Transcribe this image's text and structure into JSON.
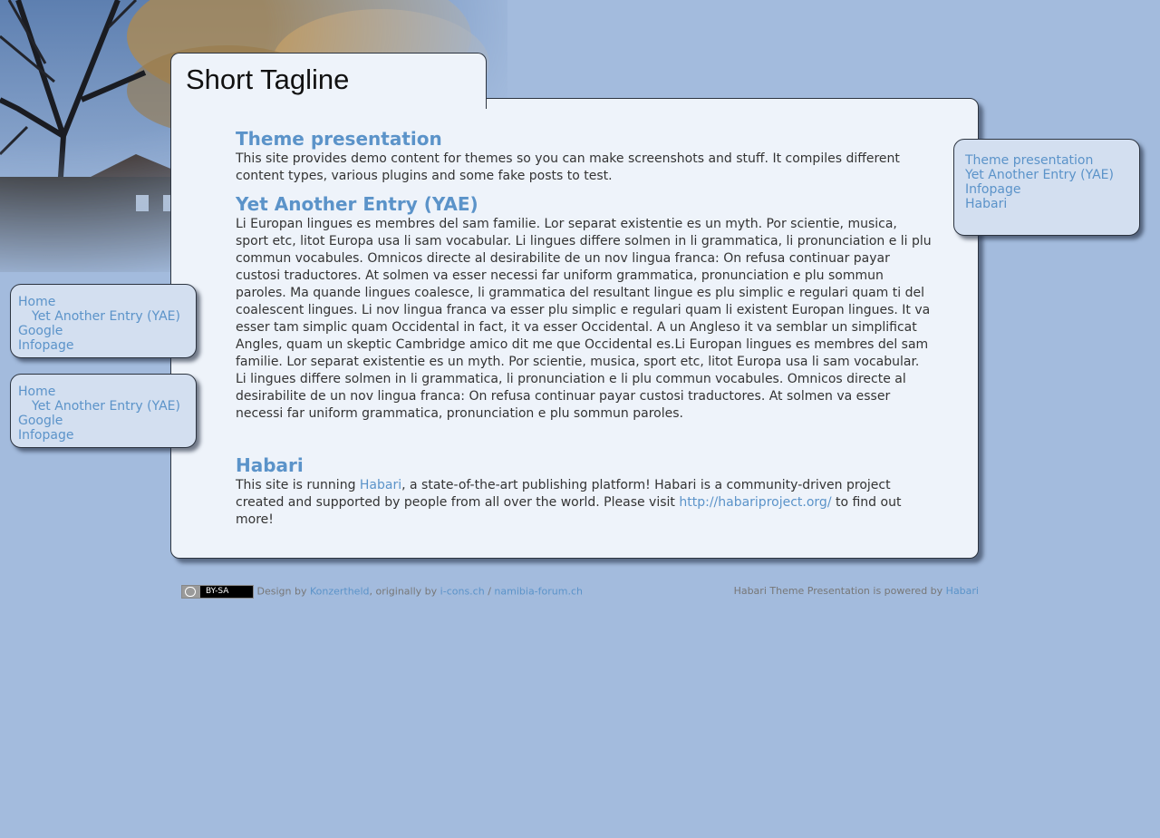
{
  "site": {
    "tagline": "Short Tagline"
  },
  "posts": [
    {
      "title": "Theme presentation",
      "body": "This site provides demo content for themes so you can make screenshots and stuff. It compiles different content types, various plugins and some fake posts to test."
    },
    {
      "title": "Yet Another Entry (YAE)",
      "body": "Li Europan lingues es membres del sam familie. Lor separat existentie es un myth. Por scientie, musica, sport etc, litot Europa usa li sam vocabular. Li lingues differe solmen in li grammatica, li pronunciation e li plu commun vocabules. Omnicos directe al desirabilite de un nov lingua franca: On refusa continuar payar custosi traductores. At solmen va esser necessi far uniform grammatica, pronunciation e plu sommun paroles. Ma quande lingues coalesce, li grammatica del resultant lingue es plu simplic e regulari quam ti del coalescent lingues. Li nov lingua franca va esser plu simplic e regulari quam li existent Europan lingues. It va esser tam simplic quam Occidental in fact, it va esser Occidental. A un Angleso it va semblar un simplificat Angles, quam un skeptic Cambridge amico dit me que Occidental es.Li Europan lingues es membres del sam familie. Lor separat existentie es un myth. Por scientie, musica, sport etc, litot Europa usa li sam vocabular. Li lingues differe solmen in li grammatica, li pronunciation e li plu commun vocabules. Omnicos directe al desirabilite de un nov lingua franca: On refusa continuar payar custosi traductores. At solmen va esser necessi far uniform grammatica, pronunciation e plu sommun paroles."
    }
  ],
  "habari": {
    "title": "Habari",
    "text_1": "This site is running ",
    "link_1": "Habari",
    "text_2": ", a state-of-the-art publishing platform! Habari is a community-driven project created and supported by people from all over the world. Please visit ",
    "link_2": "http://habariproject.org/",
    "text_3": " to find out more!"
  },
  "left_menus": [
    {
      "items": [
        {
          "label": "Home",
          "child": false
        },
        {
          "label": "Yet Another Entry (YAE)",
          "child": true
        },
        {
          "label": "Google",
          "child": false
        },
        {
          "label": "Infopage",
          "child": false
        }
      ]
    },
    {
      "items": [
        {
          "label": "Home",
          "child": false
        },
        {
          "label": "Yet Another Entry (YAE)",
          "child": true
        },
        {
          "label": "Google",
          "child": false
        },
        {
          "label": "Infopage",
          "child": false
        }
      ]
    }
  ],
  "right_menu": {
    "items": [
      {
        "label": "Theme presentation"
      },
      {
        "label": "Yet Another Entry (YAE)"
      },
      {
        "label": "Infopage"
      },
      {
        "label": "Habari"
      }
    ]
  },
  "footer": {
    "license_badge": "BY-SA",
    "design_by": "Design by",
    "designer": "Konzertheld",
    "originally_by": ", originally by",
    "orig_1": "i-cons.ch",
    "sep": "/",
    "orig_2": "namibia-forum.ch",
    "powered_text": "Habari Theme Presentation is powered by",
    "powered_link": "Habari"
  },
  "colors": {
    "background": "#a3bbdd",
    "panel": "#eef3fa",
    "link": "#5b93c9",
    "sidebox": "#d3dff0"
  },
  "images": {
    "header_photo": "bare-tree-and-rooftops-photo"
  }
}
